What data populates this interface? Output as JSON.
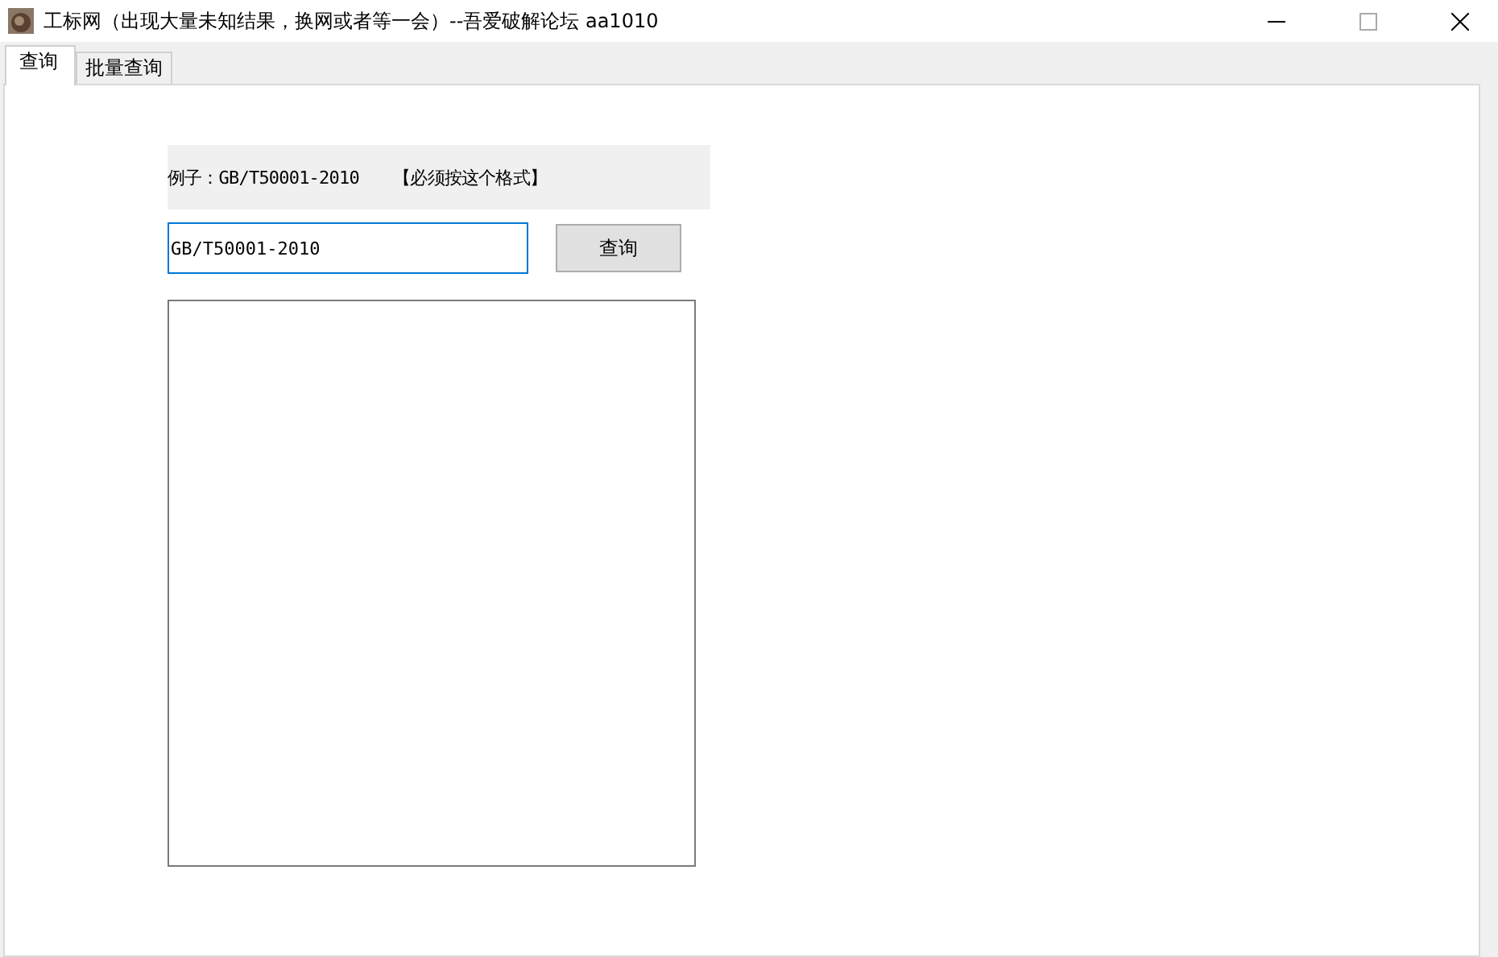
{
  "window": {
    "title": "工标网（出现大量未知结果，换网或者等一会）--吾爱破解论坛 aa1010"
  },
  "tabs": [
    {
      "label": "查询",
      "selected": true
    },
    {
      "label": "批量查询",
      "selected": false
    }
  ],
  "hint": "例子：GB/T50001-2010　　【必须按这个格式】",
  "query_field": {
    "value": "GB/T50001-2010"
  },
  "query_button": {
    "label": "查询"
  }
}
